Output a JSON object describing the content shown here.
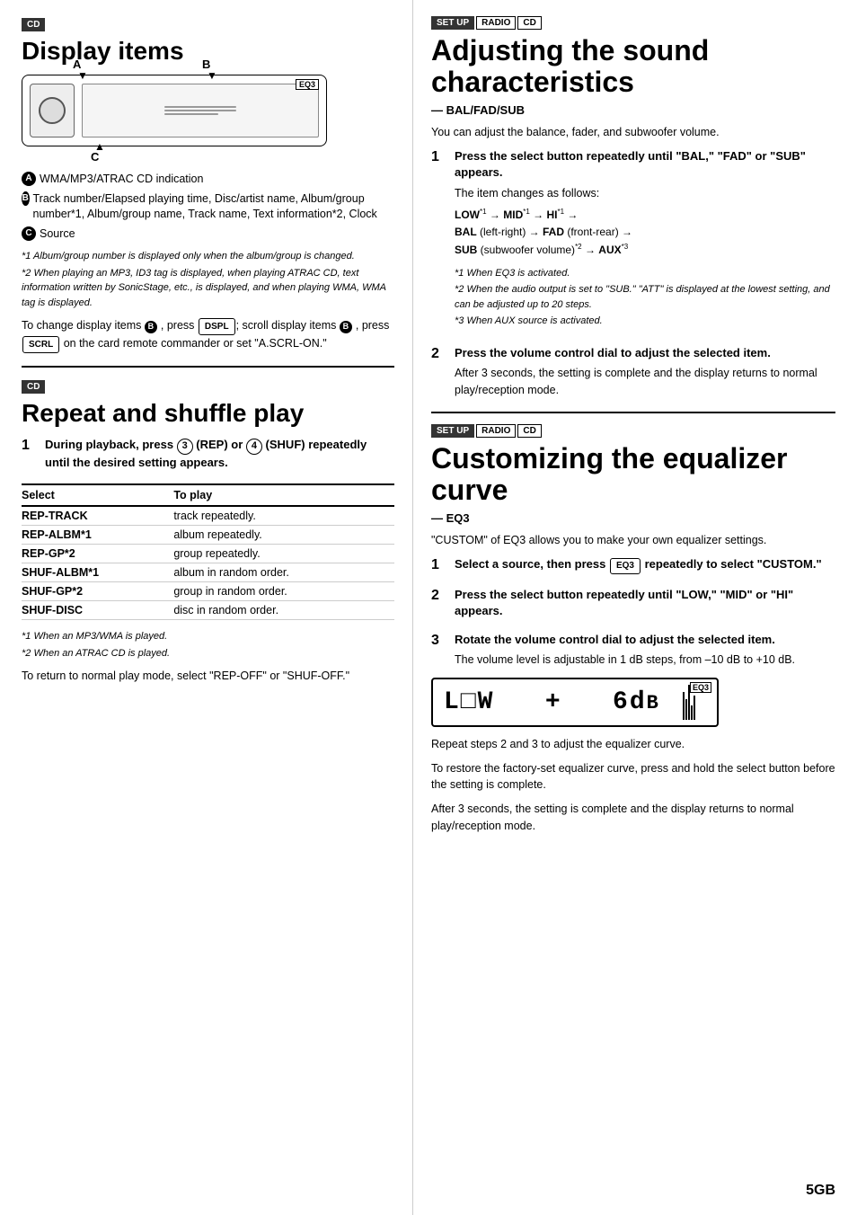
{
  "left": {
    "section1": {
      "tag": "CD",
      "title": "Display items",
      "items": [
        {
          "label": "A",
          "text": "WMA/MP3/ATRAC CD indication"
        },
        {
          "label": "B",
          "text": "Track number/Elapsed playing time, Disc/artist name, Album/group number*1, Album/group name, Track name, Text information*2, Clock"
        },
        {
          "label": "C",
          "text": "Source"
        }
      ],
      "footnotes": [
        "*1  Album/group number is displayed only when the album/group is changed.",
        "*2  When playing an MP3, ID3 tag is displayed, when playing ATRAC CD, text information written by SonicStage, etc., is displayed, and when playing WMA, WMA tag is displayed."
      ],
      "body": "To change display items B, press DSPL; scroll display items B, press SCRL on the card remote commander or set \"A.SCRL-ON.\""
    },
    "section2": {
      "tag": "CD",
      "title": "Repeat and shuffle play",
      "step1_title": "During playback, press 3 (REP) or 4 (SHUF) repeatedly until the desired setting appears.",
      "table_headers": [
        "Select",
        "To play"
      ],
      "table_rows": [
        {
          "select": "REP-TRACK",
          "play": "track repeatedly."
        },
        {
          "select": "REP-ALBM*1",
          "play": "album repeatedly."
        },
        {
          "select": "REP-GP*2",
          "play": "group repeatedly."
        },
        {
          "select": "SHUF-ALBM*1",
          "play": "album in random order."
        },
        {
          "select": "SHUF-GP*2",
          "play": "group in random order."
        },
        {
          "select": "SHUF-DISC",
          "play": "disc in random order."
        }
      ],
      "footnotes": [
        "*1  When an MP3/WMA is played.",
        "*2  When an ATRAC CD is played."
      ],
      "body": "To return to normal play mode, select \"REP-OFF\" or \"SHUF-OFF.\""
    }
  },
  "right": {
    "section1": {
      "tags": [
        "SET UP",
        "RADIO",
        "CD"
      ],
      "title": "Adjusting the sound characteristics",
      "subtitle": "— BAL/FAD/SUB",
      "intro": "You can adjust the balance, fader, and subwoofer volume.",
      "steps": [
        {
          "num": "1",
          "title": "Press the select button repeatedly until \"BAL,\" \"FAD\" or \"SUB\" appears.",
          "body": "The item changes as follows:"
        },
        {
          "num": "2",
          "title": "Press the volume control dial to adjust the selected item.",
          "body": "After 3 seconds, the setting is complete and the display returns to normal play/reception mode."
        }
      ],
      "flow": {
        "line1": "LOW*1 → MID*1 → HI*1 →",
        "line2": "BAL (left-right) → FAD (front-rear) →",
        "line3": "SUB (subwoofer volume)*2 → AUX*3"
      },
      "footnotes": [
        "*1  When EQ3 is activated.",
        "*2  When the audio output is set to \"SUB.\" \"ATT\" is displayed at the lowest setting, and can be adjusted up to 20 steps.",
        "*3  When AUX source is activated."
      ]
    },
    "section2": {
      "tags": [
        "SET UP",
        "RADIO",
        "CD"
      ],
      "title": "Customizing the equalizer curve",
      "subtitle": "— EQ3",
      "intro": "\"CUSTOM\" of EQ3 allows you to make your own equalizer settings.",
      "steps": [
        {
          "num": "1",
          "title": "Select a source, then press EQ3 repeatedly to select \"CUSTOM.\""
        },
        {
          "num": "2",
          "title": "Press the select button repeatedly until \"LOW,\" \"MID\" or \"HI\" appears."
        },
        {
          "num": "3",
          "title": "Rotate the volume control dial to adjust the selected item.",
          "body": "The volume level is adjustable in 1 dB steps, from –10 dB to +10 dB."
        }
      ],
      "display": {
        "text": "LOW  +  6dB",
        "eq_label": "EQ3"
      },
      "after_display": [
        "Repeat steps 2 and 3 to adjust the equalizer curve.",
        "To restore the factory-set equalizer curve, press and hold the select button before the setting is complete.",
        "After 3 seconds, the setting is complete and the display returns to normal play/reception mode."
      ]
    }
  },
  "page_number": "5GB"
}
